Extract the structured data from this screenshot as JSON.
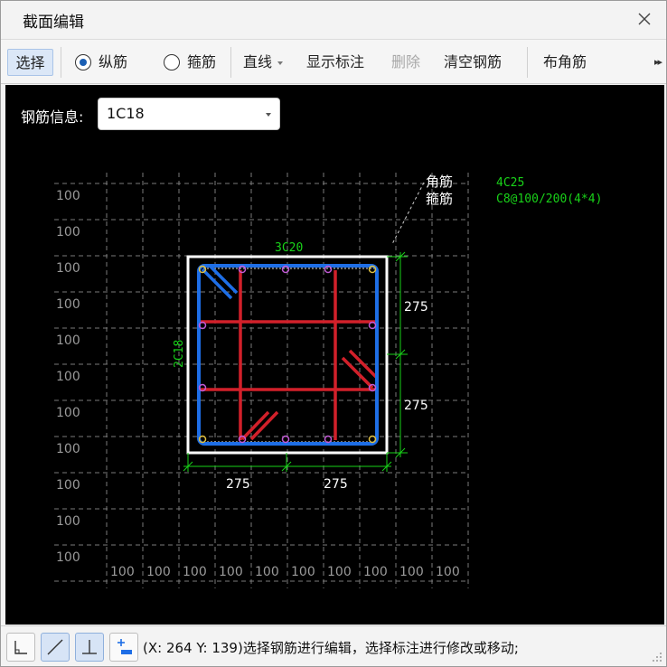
{
  "window": {
    "title": "截面编辑"
  },
  "toolbar": {
    "select_label": "选择",
    "longitudinal_label": "纵筋",
    "stirrup_label": "箍筋",
    "line_label": "直线",
    "show_dimension_label": "显示标注",
    "delete_label": "删除",
    "clear_rebar_label": "清空钢筋",
    "corner_rebar_label": "布角筋",
    "more_label": "▸▸"
  },
  "rebar_info": {
    "label": "钢筋信息:",
    "value": "1C18"
  },
  "drawing": {
    "grid_label": "100",
    "legend_corner_label": "角筋",
    "legend_stirrup_label": "箍筋",
    "corner_spec": "4C25",
    "stirrup_spec": "C8@100/200(4*4)",
    "top_rebar_label": "3C20",
    "side_rebar_label": "2C18",
    "dim_right_top": "275",
    "dim_right_bottom": "275",
    "dim_bottom_left": "275",
    "dim_bottom_right": "275",
    "colors": {
      "section_outline": "#ffffff",
      "stirrup_outer": "#1e6ee6",
      "stirrup_inner": "#d2202a",
      "dimension": "#19d219",
      "annotation_green": "#19d219",
      "point": "#c25ad6",
      "grid": "#7a7a7a"
    }
  },
  "statusbar": {
    "text": "(X: 264 Y: 139)选择钢筋进行编辑，选择标注进行修改或移动;",
    "icons": [
      "orthogonal-icon",
      "diagonal-line-icon",
      "perpendicular-icon",
      "add-dimension-icon"
    ]
  }
}
